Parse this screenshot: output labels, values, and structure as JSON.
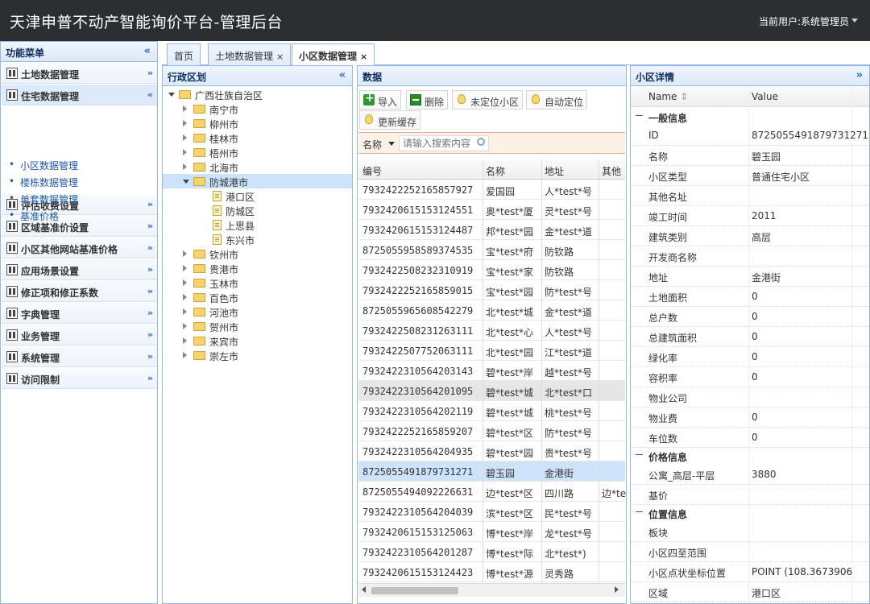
{
  "app": {
    "title": "天津申普不动产智能询价平台-管理后台",
    "user_label": "当前用户:系统管理员"
  },
  "left": {
    "title": "功能菜单",
    "collapse_glyph": "«",
    "sections": [
      {
        "label": "土地数据管理",
        "icon": "building-icon",
        "chevron": "»"
      },
      {
        "label": "住宅数据管理",
        "icon": "building-icon",
        "chevron": "«"
      },
      {
        "label": "评估收费设置",
        "icon": "building-icon",
        "chevron": "»"
      },
      {
        "label": "区域基准价设置",
        "icon": "building-icon",
        "chevron": "»"
      },
      {
        "label": "小区其他网站基准价格",
        "icon": "building-icon",
        "chevron": "»"
      },
      {
        "label": "应用场景设置",
        "icon": "person-icon",
        "chevron": "»"
      },
      {
        "label": "修正项和修正系数",
        "icon": "home-icon",
        "chevron": "»"
      },
      {
        "label": "字典管理",
        "icon": "tree-icon",
        "chevron": "»"
      },
      {
        "label": "业务管理",
        "icon": "tools-icon",
        "chevron": "»"
      },
      {
        "label": "系统管理",
        "icon": "cart-icon",
        "chevron": "»"
      },
      {
        "label": "访问限制",
        "icon": "cart-icon",
        "chevron": "»"
      }
    ],
    "subitems": [
      "小区数据管理",
      "楼栋数据管理",
      "单套数据管理",
      "基准价格"
    ]
  },
  "tabs": [
    {
      "label": "首页",
      "close": ""
    },
    {
      "label": "土地数据管理",
      "close": "×"
    },
    {
      "label": "小区数据管理",
      "close": "×"
    }
  ],
  "region": {
    "title": "行政区划",
    "collapse_glyph": "«",
    "nodes": [
      {
        "label": "广西壮族自治区",
        "level": 0,
        "type": "folder",
        "open": true
      },
      {
        "label": "南宁市",
        "level": 1,
        "type": "folder"
      },
      {
        "label": "柳州市",
        "level": 1,
        "type": "folder"
      },
      {
        "label": "桂林市",
        "level": 1,
        "type": "folder"
      },
      {
        "label": "梧州市",
        "level": 1,
        "type": "folder"
      },
      {
        "label": "北海市",
        "level": 1,
        "type": "folder"
      },
      {
        "label": "防城港市",
        "level": 1,
        "type": "folder",
        "open": true,
        "selected": true
      },
      {
        "label": "港口区",
        "level": 2,
        "type": "doc"
      },
      {
        "label": "防城区",
        "level": 2,
        "type": "doc"
      },
      {
        "label": "上思县",
        "level": 2,
        "type": "doc"
      },
      {
        "label": "东兴市",
        "level": 2,
        "type": "doc"
      },
      {
        "label": "钦州市",
        "level": 1,
        "type": "folder"
      },
      {
        "label": "贵港市",
        "level": 1,
        "type": "folder"
      },
      {
        "label": "玉林市",
        "level": 1,
        "type": "folder"
      },
      {
        "label": "百色市",
        "level": 1,
        "type": "folder"
      },
      {
        "label": "河池市",
        "level": 1,
        "type": "folder"
      },
      {
        "label": "贺州市",
        "level": 1,
        "type": "folder"
      },
      {
        "label": "来宾市",
        "level": 1,
        "type": "folder"
      },
      {
        "label": "崇左市",
        "level": 1,
        "type": "folder"
      }
    ]
  },
  "data": {
    "title": "数据",
    "toolbar": {
      "import": "导入",
      "delete": "删除",
      "unlocated": "未定位小区",
      "auto_locate": "自动定位",
      "refresh_cache": "更新缓存"
    },
    "search": {
      "field": "名称",
      "placeholder": "请输入搜索内容"
    },
    "columns": [
      "编号",
      "名称",
      "地址",
      "其他"
    ],
    "rows": [
      {
        "id": "7932422252165857927",
        "name": "爱国园",
        "addr": "人*test*号",
        "other": "",
        "state": ""
      },
      {
        "id": "7932420615153124551",
        "name": "奥*test*厦",
        "addr": "灵*test*号",
        "other": "",
        "state": ""
      },
      {
        "id": "7932420615153124487",
        "name": "邦*test*园",
        "addr": "金*test*道",
        "other": "",
        "state": ""
      },
      {
        "id": "8725055958589374535",
        "name": "宝*test*府",
        "addr": "防钦路",
        "other": "",
        "state": ""
      },
      {
        "id": "7932422508232310919",
        "name": "宝*test*家",
        "addr": "防钦路",
        "other": "",
        "state": ""
      },
      {
        "id": "7932422252165859015",
        "name": "宝*test*园",
        "addr": "防*test*号",
        "other": "",
        "state": ""
      },
      {
        "id": "8725055965608542279",
        "name": "北*test*城",
        "addr": "金*test*道",
        "other": "",
        "state": ""
      },
      {
        "id": "7932422508231263111",
        "name": "北*test*心",
        "addr": "人*test*号",
        "other": "",
        "state": ""
      },
      {
        "id": "7932422507752063111",
        "name": "北*test*园",
        "addr": "江*test*道",
        "other": "",
        "state": ""
      },
      {
        "id": "7932422310564203143",
        "name": "碧*test*岸",
        "addr": "越*test*号",
        "other": "",
        "state": ""
      },
      {
        "id": "7932422310564201095",
        "name": "碧*test*城",
        "addr": "北*test*口",
        "other": "",
        "state": "alt"
      },
      {
        "id": "7932422310564202119",
        "name": "碧*test*城",
        "addr": "桃*test*号",
        "other": "",
        "state": ""
      },
      {
        "id": "7932422252165859207",
        "name": "碧*test*区",
        "addr": "防*test*号",
        "other": "",
        "state": ""
      },
      {
        "id": "7932422310564204935",
        "name": "碧*test*园",
        "addr": "贵*test*号",
        "other": "",
        "state": ""
      },
      {
        "id": "8725055491879731271",
        "name": "碧玉园",
        "addr": "金港街",
        "other": "",
        "state": "sel"
      },
      {
        "id": "8725055494092226631",
        "name": "边*test*区",
        "addr": "四川路",
        "other": "边*te",
        "state": ""
      },
      {
        "id": "7932422310564204039",
        "name": "滨*test*区",
        "addr": "民*test*号",
        "other": "",
        "state": ""
      },
      {
        "id": "7932420615153125063",
        "name": "博*test*岸",
        "addr": "龙*test*号",
        "other": "",
        "state": ""
      },
      {
        "id": "7932422310564201287",
        "name": "博*test*际",
        "addr": "北*test*)",
        "other": "",
        "state": ""
      },
      {
        "id": "7932420615153124423",
        "name": "博*test*源",
        "addr": "灵秀路",
        "other": "",
        "state": ""
      }
    ]
  },
  "detail": {
    "title": "小区详情",
    "expand_glyph": "»",
    "col_name": "Name",
    "col_value": "Value",
    "groups": [
      {
        "title": "一般信息",
        "rows": [
          {
            "k": "ID",
            "v": "8725055491879731271"
          },
          {
            "k": "名称",
            "v": "碧玉园"
          },
          {
            "k": "小区类型",
            "v": "普通住宅小区"
          },
          {
            "k": "其他名址",
            "v": ""
          },
          {
            "k": "竣工时间",
            "v": "2011"
          },
          {
            "k": "建筑类别",
            "v": "高层"
          },
          {
            "k": "开发商名称",
            "v": ""
          },
          {
            "k": "地址",
            "v": "金港街"
          },
          {
            "k": "土地面积",
            "v": "0"
          },
          {
            "k": "总户数",
            "v": "0"
          },
          {
            "k": "总建筑面积",
            "v": "0"
          },
          {
            "k": "绿化率",
            "v": "0"
          },
          {
            "k": "容积率",
            "v": "0"
          },
          {
            "k": "物业公司",
            "v": ""
          },
          {
            "k": "物业费",
            "v": "0"
          },
          {
            "k": "车位数",
            "v": "0"
          }
        ]
      },
      {
        "title": "价格信息",
        "rows": [
          {
            "k": "公寓_高层-平层",
            "v": "3880"
          },
          {
            "k": "基价",
            "v": ""
          }
        ]
      },
      {
        "title": "位置信息",
        "rows": [
          {
            "k": "板块",
            "v": ""
          },
          {
            "k": "小区四至范围",
            "v": ""
          },
          {
            "k": "小区点状坐标位置",
            "v": "POINT (108.3673906"
          },
          {
            "k": "区域",
            "v": "港口区"
          }
        ]
      }
    ]
  }
}
